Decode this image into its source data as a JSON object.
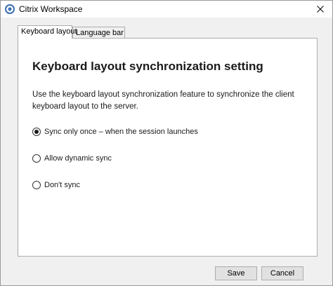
{
  "window": {
    "title": "Citrix Workspace",
    "close_symbol": "✕"
  },
  "tabs": [
    {
      "label": "Keyboard layout",
      "active": true
    },
    {
      "label": "Language bar",
      "active": false
    }
  ],
  "main": {
    "heading": "Keyboard layout synchronization setting",
    "description": "Use the keyboard layout synchronization feature to synchronize the client keyboard layout to the server.",
    "options": [
      {
        "label": "Sync only once – when the session launches",
        "selected": true
      },
      {
        "label": "Allow dynamic sync",
        "selected": false
      },
      {
        "label": "Don't sync",
        "selected": false
      }
    ]
  },
  "footer": {
    "save_label": "Save",
    "cancel_label": "Cancel"
  },
  "icons": {
    "app_icon": "citrix-swirl-icon",
    "close_icon": "close-icon"
  },
  "colors": {
    "app_icon_blue": "#3a6fb3",
    "window_bg": "#f0f0f0",
    "panel_bg": "#ffffff"
  }
}
